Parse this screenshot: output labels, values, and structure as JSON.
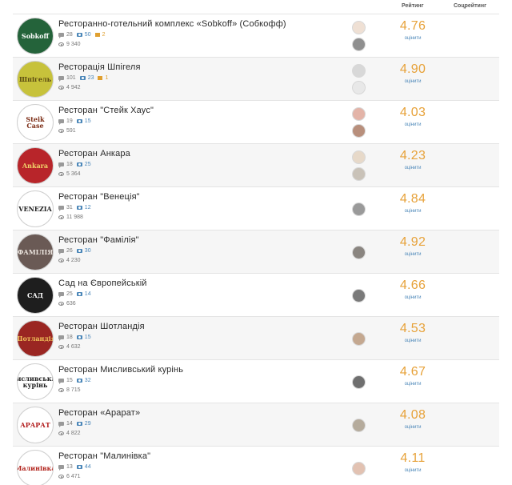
{
  "header": {
    "rating_label": "Рейтинг",
    "social_label": "Соцрейтинг"
  },
  "restaurants": [
    {
      "name": "Ресторанно-готельний комплекс «Sobkoff» (Собкофф)",
      "comments": "28",
      "photos": "50",
      "flags": "2",
      "views": "9 340",
      "rating": "4.76",
      "rating_label": "оцінити",
      "logo": {
        "text": "Sobkoff",
        "bg": "#24633a",
        "fg": "#ffffff"
      },
      "avatars": [
        "#efe0d4",
        "#8f8f8f"
      ]
    },
    {
      "name": "Ресторація Шпігеля",
      "comments": "101",
      "photos": "23",
      "flags": "1",
      "views": "4 942",
      "rating": "4.90",
      "rating_label": "оцінити",
      "logo": {
        "text": "Шпігель",
        "bg": "#c7c23b",
        "fg": "#5a4a12"
      },
      "avatars": [
        "#d8d8d8",
        "#e8e8e8"
      ]
    },
    {
      "name": "Ресторан \"Стейк Хаус\"",
      "comments": "19",
      "photos": "15",
      "flags": "",
      "views": "591",
      "rating": "4.03",
      "rating_label": "оцінити",
      "logo": {
        "text": "Steik Case",
        "bg": "#ffffff",
        "fg": "#7a2a12"
      },
      "avatars": [
        "#e3b4a8",
        "#b88f7c"
      ]
    },
    {
      "name": "Ресторан Анкара",
      "comments": "18",
      "photos": "25",
      "flags": "",
      "views": "5 364",
      "rating": "4.23",
      "rating_label": "оцінити",
      "logo": {
        "text": "Ankara",
        "bg": "#b8252a",
        "fg": "#f1d36a"
      },
      "avatars": [
        "#e7d9c9",
        "#c9c2b8"
      ]
    },
    {
      "name": "Ресторан \"Венеція\"",
      "comments": "31",
      "photos": "12",
      "flags": "",
      "views": "11 988",
      "rating": "4.84",
      "rating_label": "оцінити",
      "logo": {
        "text": "VENEZIA",
        "bg": "#ffffff",
        "fg": "#222222"
      },
      "avatars": [
        "#9a9a9a"
      ]
    },
    {
      "name": "Ресторан \"Фамілія\"",
      "comments": "26",
      "photos": "30",
      "flags": "",
      "views": "4 230",
      "rating": "4.92",
      "rating_label": "оцінити",
      "logo": {
        "text": "ФАМІЛІЯ",
        "bg": "#6a5a55",
        "fg": "#e9e2dc"
      },
      "avatars": [
        "#8a8580"
      ]
    },
    {
      "name": "Сад на Європейській",
      "comments": "25",
      "photos": "14",
      "flags": "",
      "views": "636",
      "rating": "4.66",
      "rating_label": "оцінити",
      "logo": {
        "text": "САД",
        "bg": "#1e1e1e",
        "fg": "#ffffff"
      },
      "avatars": [
        "#7a7a7a"
      ]
    },
    {
      "name": "Ресторан Шотландія",
      "comments": "18",
      "photos": "15",
      "flags": "",
      "views": "4 632",
      "rating": "4.53",
      "rating_label": "оцінити",
      "logo": {
        "text": "Шотландія",
        "bg": "#9a2622",
        "fg": "#f0c25a"
      },
      "avatars": [
        "#c4a890"
      ]
    },
    {
      "name": "Ресторан Мисливський курінь",
      "comments": "15",
      "photos": "32",
      "flags": "",
      "views": "8 715",
      "rating": "4.67",
      "rating_label": "оцінити",
      "logo": {
        "text": "Мисливський курінь",
        "bg": "#ffffff",
        "fg": "#222222"
      },
      "avatars": [
        "#6f6f6f"
      ]
    },
    {
      "name": "Ресторан «Арарат»",
      "comments": "14",
      "photos": "29",
      "flags": "",
      "views": "4 822",
      "rating": "4.08",
      "rating_label": "оцінити",
      "logo": {
        "text": "АРАРАТ",
        "bg": "#ffffff",
        "fg": "#b21e1e"
      },
      "avatars": [
        "#b5ab9c"
      ]
    },
    {
      "name": "Ресторан \"Малинівка\"",
      "comments": "13",
      "photos": "44",
      "flags": "",
      "views": "6 471",
      "rating": "4.11",
      "rating_label": "оцінити",
      "logo": {
        "text": "Малинівка",
        "bg": "#ffffff",
        "fg": "#b2251e"
      },
      "avatars": [
        "#e2c2b2"
      ]
    }
  ]
}
